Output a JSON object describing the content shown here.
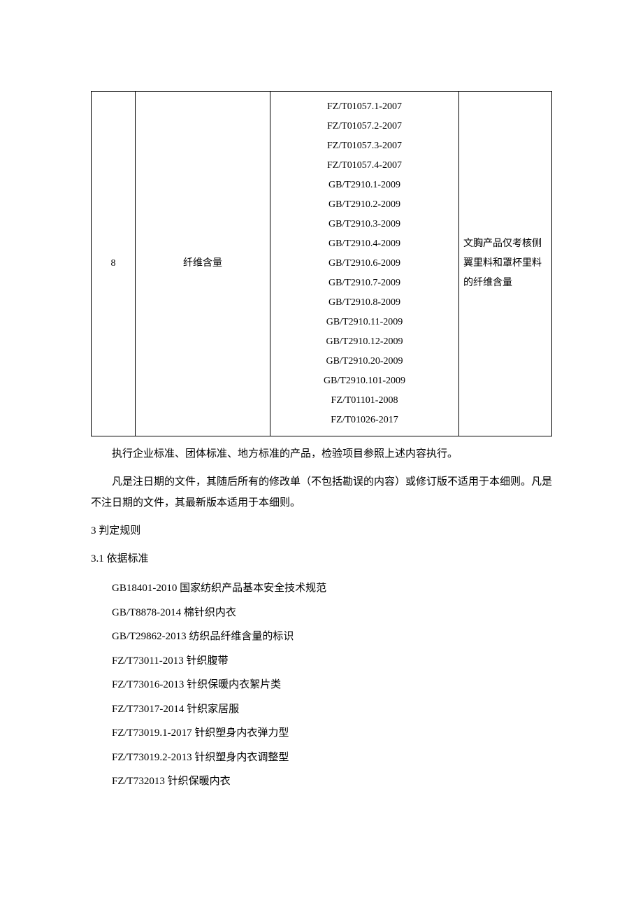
{
  "table": {
    "row": {
      "index": "8",
      "item": "纤维含量",
      "methods": [
        "FZ/T01057.1-2007",
        "FZ/T01057.2-2007",
        "FZ/T01057.3-2007",
        "FZ/T01057.4-2007",
        "GB/T2910.1-2009",
        "GB/T2910.2-2009",
        "GB/T2910.3-2009",
        "GB/T2910.4-2009",
        "GB/T2910.6-2009",
        "GB/T2910.7-2009",
        "GB/T2910.8-2009",
        "GB/T2910.11-2009",
        "GB/T2910.12-2009",
        "GB/T2910.20-2009",
        "GB/T2910.101-2009",
        "FZ/T01101-2008",
        "FZ/T01026-2017"
      ],
      "note": "文胸产品仅考核侧翼里料和罩杯里料的纤维含量"
    }
  },
  "paragraphs": {
    "p1": "执行企业标准、团体标准、地方标准的产品，检验项目参照上述内容执行。",
    "p2": "凡是注日期的文件，其随后所有的修改单（不包括勘误的内容）或修订版不适用于本细则。凡是不注日期的文件，其最新版本适用于本细则。"
  },
  "sections": {
    "s3": "3 判定规则",
    "s3_1": "3.1  依据标准"
  },
  "standards": [
    "GB18401-2010 国家纺织产品基本安全技术规范",
    "GB/T8878-2014 棉针织内衣",
    "GB/T29862-2013 纺织品纤维含量的标识",
    "FZ/T73011-2013 针织腹带",
    "FZ/T73016-2013 针织保暖内衣絮片类",
    "FZ/T73017-2014 针织家居服",
    "FZ/T73019.1-2017 针织塑身内衣弹力型",
    "FZ/T73019.2-2013 针织塑身内衣调整型",
    "FZ/T732013 针织保暖内衣"
  ]
}
